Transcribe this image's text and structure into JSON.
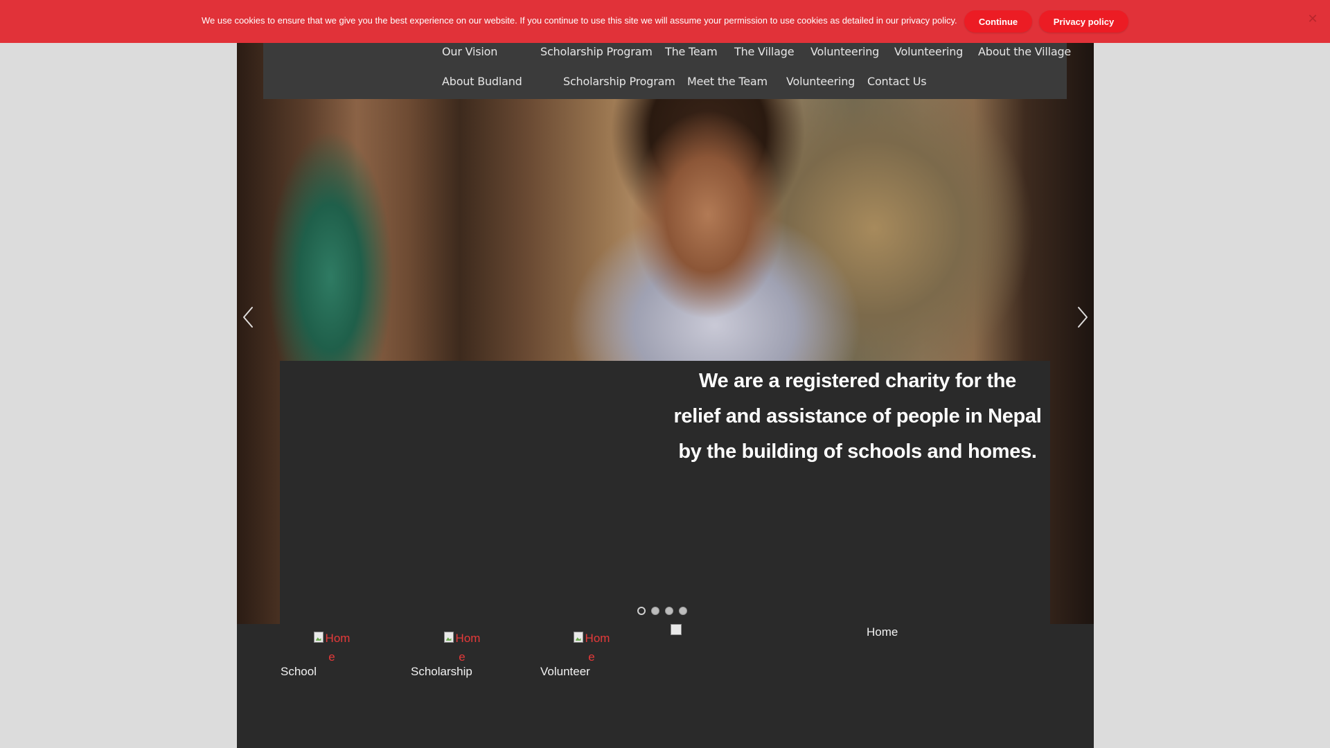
{
  "cookie_bar": {
    "message": "We use cookies to ensure that we give you the best experience on our website. If you continue to use this site we will assume your permission to use cookies as detailed in our privacy policy.",
    "continue_label": "Continue",
    "privacy_label": "Privacy policy",
    "close_glyph": "✕",
    "background": "#e13239"
  },
  "nav": {
    "row1": [
      "Our Vision",
      "Scholarship Program",
      "The Team",
      "The Village",
      "Volunteering",
      "Volunteering",
      "About the Village"
    ],
    "row2": [
      "About Budland",
      "Scholarship Program",
      "Meet the Team",
      "Volunteering",
      "Contact Us"
    ]
  },
  "hero": {
    "tagline_lines": [
      "We are a  registered charity for the",
      "relief and assistance of people in Nepal",
      "by  the building of schools and  homes."
    ],
    "slide_count": 4,
    "active_slide": 1
  },
  "features": [
    {
      "image_alt": "Home",
      "label": "School"
    },
    {
      "image_alt": "Home",
      "label": "Scholarship"
    },
    {
      "image_alt": "Home",
      "label": "Volunteer"
    }
  ],
  "home_link": "Home",
  "icons": {
    "prev": "chevron-left-icon",
    "next": "chevron-right-icon",
    "broken_image": "broken-image-icon"
  }
}
